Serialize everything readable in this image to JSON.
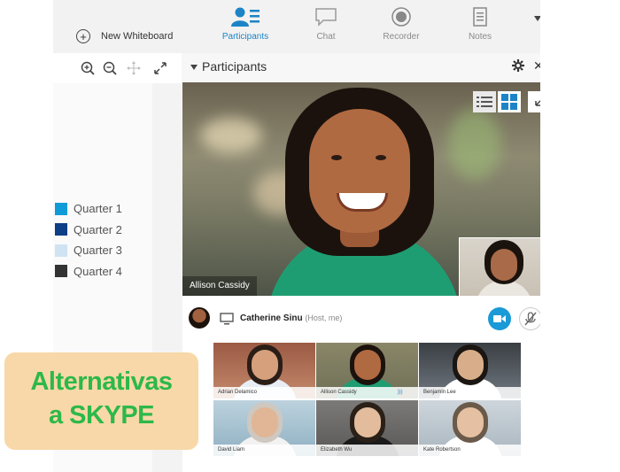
{
  "toolbar": {
    "new_whiteboard": "New Whiteboard",
    "tabs": [
      {
        "label": "Participants",
        "icon": "participants-icon",
        "active": true
      },
      {
        "label": "Chat",
        "icon": "chat-icon",
        "active": false
      },
      {
        "label": "Recorder",
        "icon": "recorder-icon",
        "active": false
      },
      {
        "label": "Notes",
        "icon": "notes-icon",
        "active": false
      }
    ]
  },
  "panel": {
    "title": "Participants"
  },
  "main_video": {
    "name": "Allison Cassidy"
  },
  "host": {
    "name": "Catherine Sinu",
    "role": "(Host, me)"
  },
  "grid": [
    {
      "name": "Adrian Delamico"
    },
    {
      "name": "Allison Cassidy"
    },
    {
      "name": "Benjamin Lee"
    },
    {
      "name": "David Liam"
    },
    {
      "name": "Elizabeth Wu"
    },
    {
      "name": "Kate Robertson"
    }
  ],
  "legend": [
    {
      "label": "Quarter 1",
      "color": "#0f9bd7"
    },
    {
      "label": "Quarter 2",
      "color": "#0d3e86"
    },
    {
      "label": "Quarter 3",
      "color": "#cfe3f3"
    },
    {
      "label": "Quarter 4",
      "color": "#333333"
    }
  ],
  "overlay": {
    "line1": "Alternativas",
    "line2": "a SKYPE"
  },
  "colors": {
    "accent": "#1c84c6",
    "overlay_bg": "#f8d8a8",
    "overlay_text": "#2db84a"
  }
}
